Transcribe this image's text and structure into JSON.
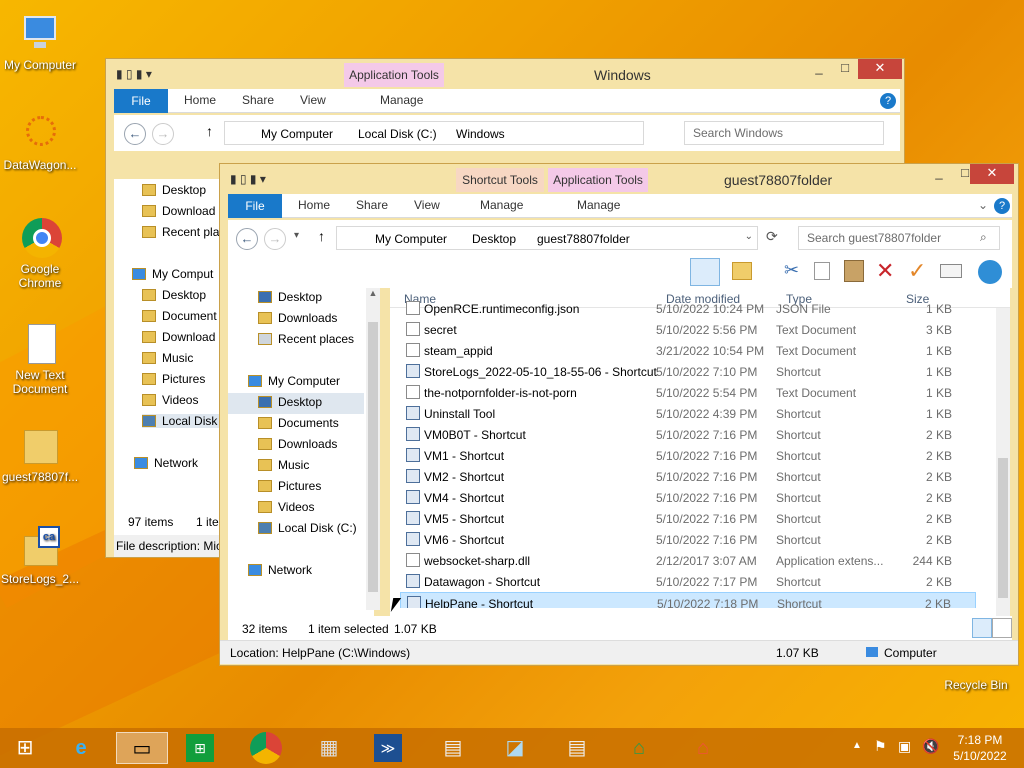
{
  "desktop": {
    "icons": [
      {
        "label": "My Computer"
      },
      {
        "label": "DataWagon..."
      },
      {
        "label": "Google Chrome"
      },
      {
        "label": "New Text Document"
      },
      {
        "label": "guest78807f..."
      },
      {
        "label": "StoreLogs_2..."
      },
      {
        "label": "Recycle Bin"
      }
    ]
  },
  "back_window": {
    "title": "Windows",
    "context_tab": "Application Tools",
    "tabs": [
      "File",
      "Home",
      "Share",
      "View",
      "Manage"
    ],
    "breadcrumb": [
      "My Computer",
      "Local Disk (C:)",
      "Windows"
    ],
    "search_placeholder": "Search Windows",
    "nav_items": [
      "Desktop",
      "Download",
      "Recent pla",
      "My Comput",
      "Desktop",
      "Document",
      "Download",
      "Music",
      "Pictures",
      "Videos",
      "Local Disk",
      "Network"
    ],
    "status_items": "97 items",
    "status_sel": "1 iter",
    "description": "File description: Mic"
  },
  "front_window": {
    "title": "guest78807folder",
    "context_tabs": [
      "Shortcut Tools",
      "Application Tools"
    ],
    "tabs": [
      "File",
      "Home",
      "Share",
      "View",
      "Manage",
      "Manage"
    ],
    "breadcrumb": [
      "My Computer",
      "Desktop",
      "guest78807folder"
    ],
    "search_placeholder": "Search guest78807folder",
    "nav_items": [
      "Desktop",
      "Downloads",
      "Recent places",
      "My Computer",
      "Desktop",
      "Documents",
      "Downloads",
      "Music",
      "Pictures",
      "Videos",
      "Local Disk (C:)",
      "Network"
    ],
    "columns": [
      "Name",
      "Date modified",
      "Type",
      "Size"
    ],
    "files": [
      {
        "name": "OpenRCE.runtimeconfig.json",
        "date": "5/10/2022 10:24 PM",
        "type": "JSON File",
        "size": "1 KB"
      },
      {
        "name": "secret",
        "date": "5/10/2022 5:56 PM",
        "type": "Text Document",
        "size": "3 KB"
      },
      {
        "name": "steam_appid",
        "date": "3/21/2022 10:54 PM",
        "type": "Text Document",
        "size": "1 KB"
      },
      {
        "name": "StoreLogs_2022-05-10_18-55-06 - Shortcut",
        "date": "5/10/2022 7:10 PM",
        "type": "Shortcut",
        "size": "1 KB"
      },
      {
        "name": "the-notpornfolder-is-not-porn",
        "date": "5/10/2022 5:54 PM",
        "type": "Text Document",
        "size": "1 KB"
      },
      {
        "name": "Uninstall Tool",
        "date": "5/10/2022 4:39 PM",
        "type": "Shortcut",
        "size": "1 KB"
      },
      {
        "name": "VM0B0T - Shortcut",
        "date": "5/10/2022 7:16 PM",
        "type": "Shortcut",
        "size": "2 KB"
      },
      {
        "name": "VM1 - Shortcut",
        "date": "5/10/2022 7:16 PM",
        "type": "Shortcut",
        "size": "2 KB"
      },
      {
        "name": "VM2 - Shortcut",
        "date": "5/10/2022 7:16 PM",
        "type": "Shortcut",
        "size": "2 KB"
      },
      {
        "name": "VM4 - Shortcut",
        "date": "5/10/2022 7:16 PM",
        "type": "Shortcut",
        "size": "2 KB"
      },
      {
        "name": "VM5 - Shortcut",
        "date": "5/10/2022 7:16 PM",
        "type": "Shortcut",
        "size": "2 KB"
      },
      {
        "name": "VM6 - Shortcut",
        "date": "5/10/2022 7:16 PM",
        "type": "Shortcut",
        "size": "2 KB"
      },
      {
        "name": "websocket-sharp.dll",
        "date": "2/12/2017 3:07 AM",
        "type": "Application extens...",
        "size": "244 KB"
      },
      {
        "name": "Datawagon - Shortcut",
        "date": "5/10/2022 7:17 PM",
        "type": "Shortcut",
        "size": "2 KB"
      },
      {
        "name": "HelpPane - Shortcut",
        "date": "5/10/2022 7:18 PM",
        "type": "Shortcut",
        "size": "2 KB"
      }
    ],
    "status_items": "32 items",
    "status_sel": "1 item selected",
    "status_size": "1.07 KB",
    "location": "Location: HelpPane (C:\\Windows)",
    "loc_size": "1.07 KB",
    "loc_zone": "Computer"
  },
  "taskbar": {
    "time": "7:18 PM",
    "date": "5/10/2022"
  },
  "colors": {
    "accent": "#1979ca",
    "context_pink": "#f4c9e8",
    "context_orange": "#f7d7c3"
  }
}
